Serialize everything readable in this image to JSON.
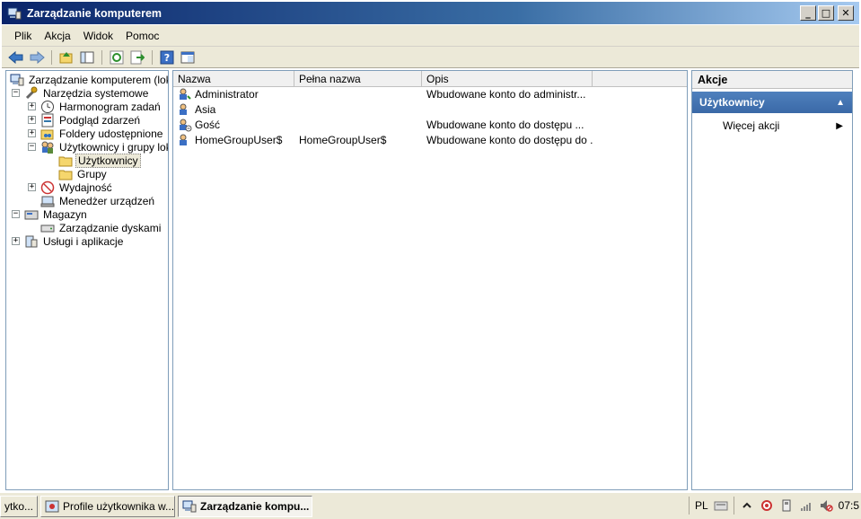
{
  "window": {
    "title": "Zarządzanie komputerem"
  },
  "menu": [
    "Plik",
    "Akcja",
    "Widok",
    "Pomoc"
  ],
  "toolbar": [
    "back-icon",
    "forward-icon",
    "up-icon",
    "show-hide-tree-icon",
    "refresh-icon",
    "export-icon",
    "help-icon",
    "properties-icon"
  ],
  "tree": [
    {
      "label": "Zarządzanie komputerem (lokalne)",
      "icon": "computer-management-icon"
    },
    {
      "label": "Narzędzia systemowe",
      "icon": "tools-icon"
    },
    {
      "label": "Harmonogram zadań",
      "icon": "clock-icon"
    },
    {
      "label": "Podgląd zdarzeń",
      "icon": "event-viewer-icon"
    },
    {
      "label": "Foldery udostępnione",
      "icon": "shared-folder-icon"
    },
    {
      "label": "Użytkownicy i grupy lokalne",
      "icon": "users-icon"
    },
    {
      "label": "Użytkownicy",
      "icon": "folder-icon"
    },
    {
      "label": "Grupy",
      "icon": "folder-icon"
    },
    {
      "label": "Wydajność",
      "icon": "performance-icon"
    },
    {
      "label": "Menedżer urządzeń",
      "icon": "device-manager-icon"
    },
    {
      "label": "Magazyn",
      "icon": "storage-icon"
    },
    {
      "label": "Zarządzanie dyskami",
      "icon": "disk-icon"
    },
    {
      "label": "Usługi i aplikacje",
      "icon": "services-icon"
    }
  ],
  "list": {
    "columns": [
      "Nazwa",
      "Pełna nazwa",
      "Opis"
    ],
    "rows": [
      {
        "name": "Administrator",
        "full": "",
        "desc": "Wbudowane konto do administr..."
      },
      {
        "name": "Asia",
        "full": "",
        "desc": ""
      },
      {
        "name": "Gość",
        "full": "",
        "desc": "Wbudowane konto do dostępu ..."
      },
      {
        "name": "HomeGroupUser$",
        "full": "HomeGroupUser$",
        "desc": "Wbudowane konto do dostępu do ..."
      }
    ]
  },
  "actions": {
    "header": "Akcje",
    "section": "Użytkownicy",
    "more": "Więcej akcji"
  },
  "taskbar": {
    "items": [
      {
        "label": "ytko..."
      },
      {
        "label": "Profile użytkownika w..."
      },
      {
        "label": "Zarządzanie kompu..."
      }
    ],
    "lang": "PL",
    "clock": "07:5"
  }
}
